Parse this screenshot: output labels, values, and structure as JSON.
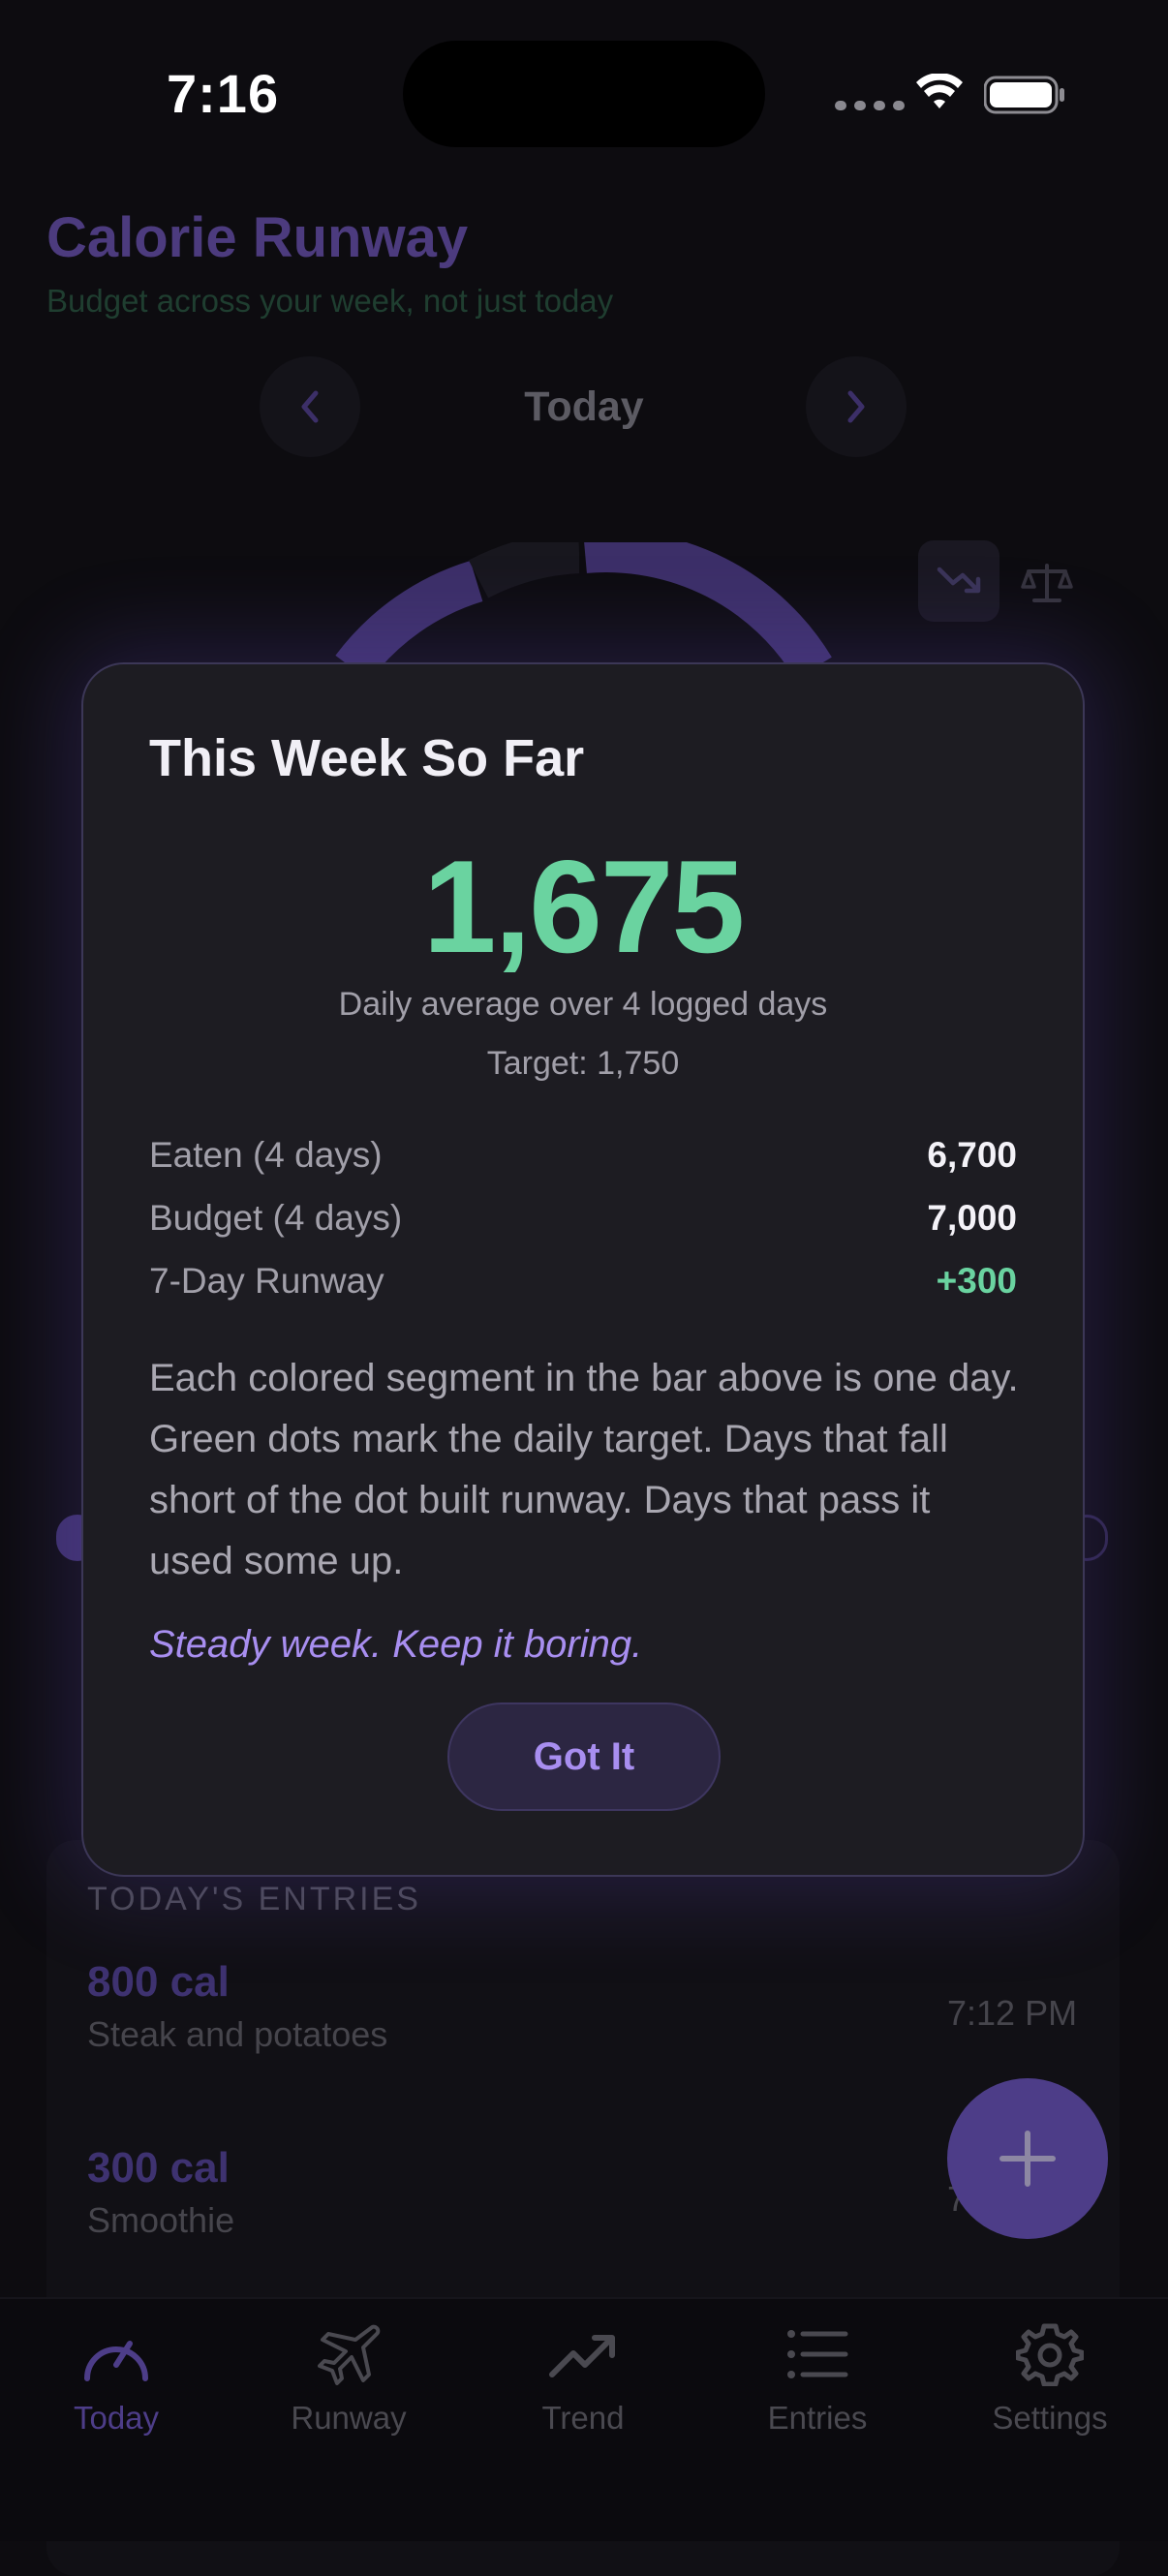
{
  "status_bar": {
    "time": "7:16"
  },
  "app": {
    "title": "Calorie Runway",
    "subtitle": "Budget across your week, not just today",
    "day_nav": {
      "label": "Today"
    }
  },
  "entries": {
    "header": "TODAY'S ENTRIES",
    "items": [
      {
        "calories": "800 cal",
        "description": "Steak and potatoes",
        "time": "7:12 PM"
      },
      {
        "calories": "300 cal",
        "description": "Smoothie",
        "time": "7"
      }
    ]
  },
  "tabs": [
    {
      "label": "Today",
      "icon": "gauge-icon",
      "active": true
    },
    {
      "label": "Runway",
      "icon": "airplane-icon",
      "active": false
    },
    {
      "label": "Trend",
      "icon": "trend-icon",
      "active": false
    },
    {
      "label": "Entries",
      "icon": "list-icon",
      "active": false
    },
    {
      "label": "Settings",
      "icon": "gear-icon",
      "active": false
    }
  ],
  "modal": {
    "title": "This Week So Far",
    "daily_average": "1,675",
    "average_caption": "Daily average over 4 logged days",
    "target": "Target: 1,750",
    "rows": [
      {
        "label": "Eaten (4 days)",
        "value": "6,700"
      },
      {
        "label": "Budget (4 days)",
        "value": "7,000"
      },
      {
        "label": "7-Day Runway",
        "value": "+300"
      }
    ],
    "explanation": "Each colored segment in the bar above is one day. Green dots mark the daily target. Days that fall short of the dot built runway. Days that pass it used some up.",
    "quote": "Steady week. Keep it boring.",
    "button": "Got It"
  },
  "colors": {
    "accent": "#a88ef0",
    "positive": "#6ad3a0",
    "modal_bg": "#1d1c22",
    "page_bg": "#0d0c10"
  }
}
